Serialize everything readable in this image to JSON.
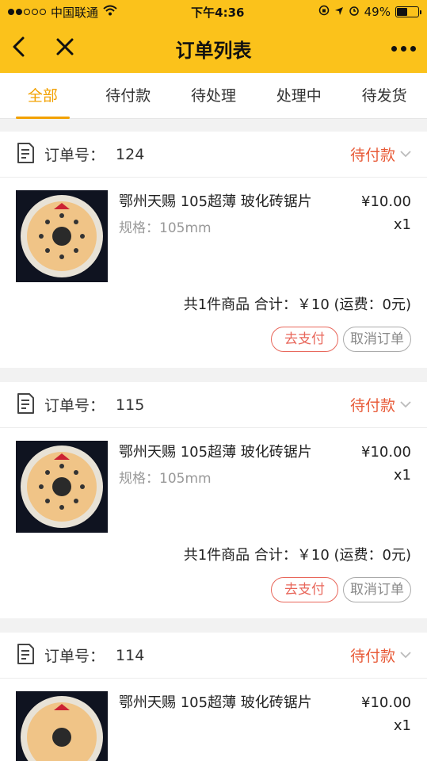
{
  "status_bar": {
    "carrier": "中国联通",
    "time": "下午4:36",
    "battery": "49%",
    "battery_level": 0.49
  },
  "nav": {
    "title": "订单列表"
  },
  "tabs": [
    {
      "label": "全部",
      "active": true
    },
    {
      "label": "待付款"
    },
    {
      "label": "待处理"
    },
    {
      "label": "处理中"
    },
    {
      "label": "待发货"
    }
  ],
  "orders": [
    {
      "label": "订单号：",
      "number": "124",
      "status": "待付款",
      "product_name": "鄂州天赐 105超薄 玻化砖锯片",
      "spec": "规格：105mm",
      "price": "¥10.00",
      "qty": "x1",
      "summary": "共1件商品 合计：￥10 (运费：0元)",
      "pay_label": "去支付",
      "cancel_label": "取消订单"
    },
    {
      "label": "订单号：",
      "number": "115",
      "status": "待付款",
      "product_name": "鄂州天赐 105超薄 玻化砖锯片",
      "spec": "规格：105mm",
      "price": "¥10.00",
      "qty": "x1",
      "summary": "共1件商品 合计：￥10 (运费：0元)",
      "pay_label": "去支付",
      "cancel_label": "取消订单"
    },
    {
      "label": "订单号：",
      "number": "114",
      "status": "待付款",
      "product_name": "鄂州天赐 105超薄 玻化砖锯片",
      "spec": "",
      "price": "¥10.00",
      "qty": "x1",
      "summary": "",
      "pay_label": "",
      "cancel_label": ""
    }
  ],
  "icons": {
    "back": "chevron-left-icon",
    "close": "close-icon",
    "more": "more-icon",
    "order": "document-icon",
    "status_arrow": "chevron-down-icon"
  },
  "colors": {
    "header": "#fbc21b",
    "active_tab": "#f2a100",
    "status": "#e85c3a",
    "pay_button": "#e8665a"
  }
}
